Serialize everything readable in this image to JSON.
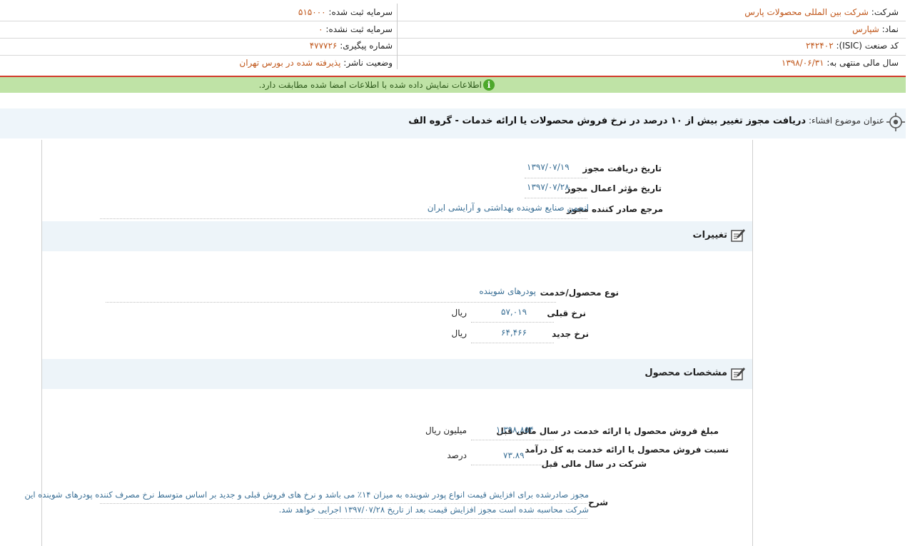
{
  "header": {
    "company_label": "شرکت:",
    "company_value": "شرکت بین المللی محصولات پارس",
    "symbol_label": "نماد:",
    "symbol_value": "شپارس",
    "isic_label": "کد صنعت (ISIC):",
    "isic_value": "۲۴۲۴۰۲",
    "fiscal_label": "سال مالی منتهی به:",
    "fiscal_value": "۱۳۹۸/۰۶/۳۱",
    "capital_registered_label": "سرمایه ثبت شده:",
    "capital_registered_value": "۵۱۵۰۰۰",
    "capital_unregistered_label": "سرمایه ثبت نشده:",
    "capital_unregistered_value": "۰",
    "tracking_label": "شماره پیگیری:",
    "tracking_value": "۴۷۷۷۲۶",
    "publisher_status_label": "وضعیت ناشر:",
    "publisher_status_value": "پذیرفته شده در بورس تهران"
  },
  "notice": {
    "icon_text": "i",
    "text": "اطلاعات نمایش داده شده با اطلاعات امضا شده مطابقت دارد."
  },
  "subject": {
    "label": "عنوان موضوع افشاء:",
    "title": "دریافت مجوز تغییر بیش از ۱۰ درصد در نرخ فروش محصولات یا ارائه خدمات - گروه الف"
  },
  "permit": {
    "received_date_label": "تاریخ دریافت مجوز",
    "received_date_value": "۱۳۹۷/۰۷/۱۹",
    "effective_date_label": "تاریخ مؤثر اعمال مجوز",
    "effective_date_value": "۱۳۹۷/۰۷/۲۸",
    "issuer_label": "مرجع صادر کننده مجوز",
    "issuer_value": "انجمن صنایع شوینده بهداشتی و آرایشی ایران"
  },
  "changes": {
    "section_title": "تغییرات",
    "product_type_label": "نوع محصول/خدمت",
    "product_type_value": "پودرهای شوینده",
    "prev_rate_label": "نرخ قبلی",
    "prev_rate_value": "۵۷,۰۱۹",
    "prev_rate_unit": "ریال",
    "new_rate_label": "نرخ جدید",
    "new_rate_value": "۶۴,۴۶۶",
    "new_rate_unit": "ریال"
  },
  "specs": {
    "section_title": "مشخصات محصول",
    "sales_amount_label": "مبلغ فروش محصول یا ارائه خدمت در سال مالی قبل",
    "sales_amount_value": "۱,۳۹۸,۸۵۴",
    "sales_amount_unit": "میلیون ریال",
    "sales_ratio_label_line1": "نسبت فروش محصول یا ارائه خدمت به کل درآمد",
    "sales_ratio_label_line2": "شرکت در سال مالی قبل",
    "sales_ratio_value": "۷۳.۸۹",
    "sales_ratio_unit": "درصد",
    "description_label": "شرح",
    "description_line1": "مجوز صادرشده برای افزایش قیمت انواع پودر شوینده به میزان ۱۴٪ می باشد و نرخ های فروش قبلی و جدید بر اساس متوسط نرخ مصرف کننده پودرهای شوینده این",
    "description_line2": "شرکت محاسبه شده است مجوز افزایش قیمت بعد از تاریخ ۱۳۹۷/۰۷/۲۸ اجرایی خواهد شد."
  },
  "colors": {
    "value_orange": "#c0571b",
    "value_blue": "#3a6f95",
    "notice_green": "#bfe3a6",
    "divider_red": "#d23a2a"
  }
}
